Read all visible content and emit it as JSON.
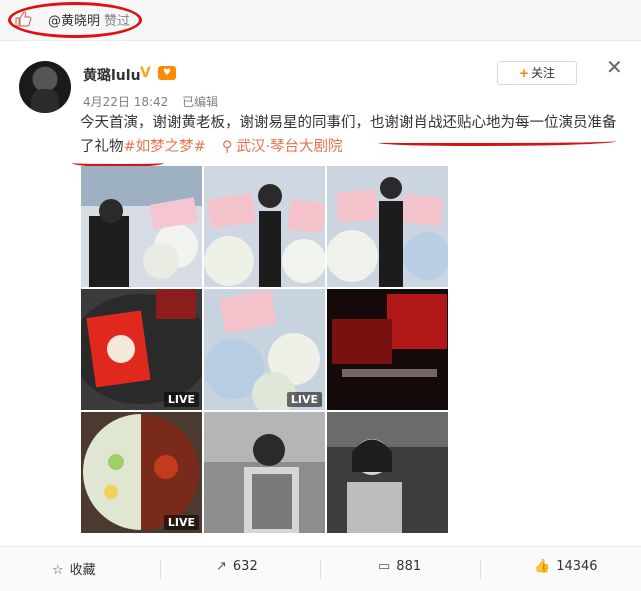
{
  "like_bar": {
    "liker": "@黄晓明",
    "action": "赞过"
  },
  "post": {
    "username": "黄璐lulu",
    "date": "4月22日 18:42",
    "edited": "已编辑",
    "follow_label": "关注",
    "text_part1": "今天首演，谢谢黄老板，谢谢易星的同事们，也谢谢肖战还贴心地为每一位演员准备了礼物",
    "hashtag": "#如梦之梦#",
    "location": "武汉·琴台大剧院",
    "images": [
      {
        "live": false
      },
      {
        "live": false
      },
      {
        "live": false
      },
      {
        "live": true,
        "badge": "LIVE"
      },
      {
        "live": true,
        "badge": "LIVE"
      },
      {
        "live": false
      },
      {
        "live": true,
        "badge": "LIVE"
      },
      {
        "live": false
      },
      {
        "live": false
      }
    ]
  },
  "toolbar": {
    "favorite_label": "收藏",
    "repost_count": "632",
    "comment_count": "881",
    "like_count": "14346"
  },
  "colors": {
    "accent": "#eb7350",
    "annotation_red": "#e01010",
    "follow_plus": "#ff8200"
  }
}
